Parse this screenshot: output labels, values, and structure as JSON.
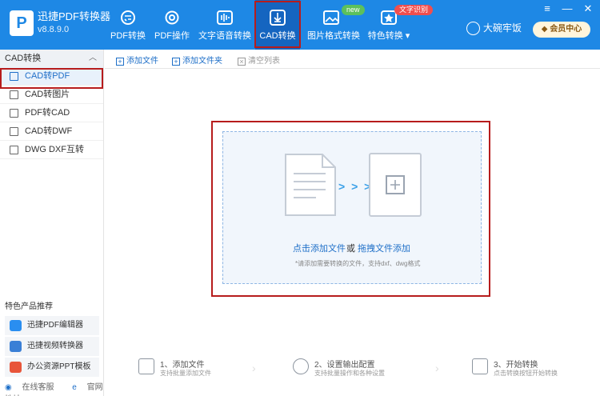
{
  "app": {
    "title": "迅捷PDF转换器",
    "version": "v8.8.9.0",
    "logo": "P"
  },
  "nav": [
    {
      "label": "PDF转换"
    },
    {
      "label": "PDF操作"
    },
    {
      "label": "文字语音转换"
    },
    {
      "label": "CAD转换"
    },
    {
      "label": "图片格式转换"
    },
    {
      "label": "特色转换"
    }
  ],
  "badges": {
    "new": "new",
    "ocr": "文字识别"
  },
  "user": {
    "name": "大碗牢饭",
    "member": "会员中心"
  },
  "window": {
    "menu": "≡",
    "minimize": "—",
    "close": "✕"
  },
  "sidebar": {
    "header": "CAD转换",
    "items": [
      {
        "label": "CAD转PDF"
      },
      {
        "label": "CAD转图片"
      },
      {
        "label": "PDF转CAD"
      },
      {
        "label": "CAD转DWF"
      },
      {
        "label": "DWG DXF互转"
      }
    ],
    "promo_title": "特色产品推荐",
    "promos": [
      {
        "label": "迅捷PDF编辑器"
      },
      {
        "label": "迅捷视频转换器"
      },
      {
        "label": "办公资源PPT模板"
      }
    ],
    "bottom": {
      "service": "在线客服",
      "website": "官网地址"
    }
  },
  "toolbar": {
    "add_file": "添加文件",
    "add_folder": "添加文件夹",
    "clear": "清空列表"
  },
  "dropzone": {
    "click_add": "点击添加文件",
    "or": "或",
    "drag_add": "拖拽文件添加",
    "hint": "*请添加需要转换的文件，支持dxf、dwg格式",
    "arrows": "> > >"
  },
  "steps": [
    {
      "title": "1、添加文件",
      "sub": "支持批量添加文件"
    },
    {
      "title": "2、设置输出配置",
      "sub": "支持批量操作和各种设置"
    },
    {
      "title": "3、开始转换",
      "sub": "点击转换按钮开始转换"
    }
  ],
  "colors": {
    "primary": "#1e88e5",
    "active_nav": "#1565c0",
    "highlight": "#b71c1c"
  }
}
